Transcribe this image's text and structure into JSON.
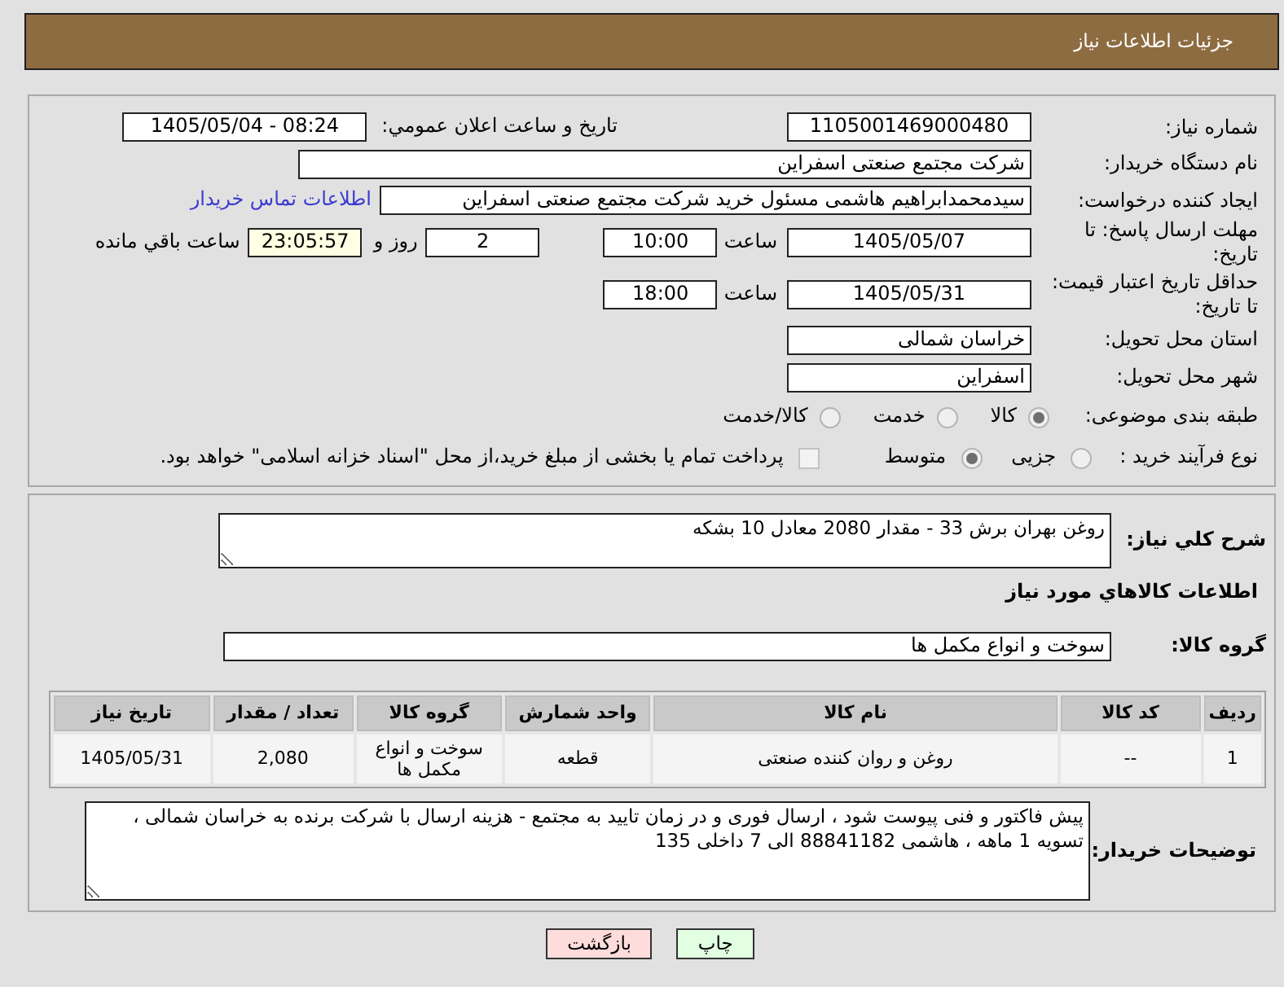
{
  "header": {
    "title": "جزئیات اطلاعات نیاز"
  },
  "details": {
    "need_number": {
      "label": "شماره نیاز:",
      "value": "1105001469000480"
    },
    "announce_datetime": {
      "label": "تاریخ و ساعت اعلان عمومي:",
      "value": "1405/05/04 - 08:24"
    },
    "buyer_org": {
      "label": "نام دستگاه خریدار:",
      "value": "شرکت مجتمع صنعتی اسفراین"
    },
    "requester": {
      "label": "ایجاد کننده درخواست:",
      "value": "سیدمحمدابراهیم هاشمی مسئول خرید شرکت مجتمع صنعتی اسفراین",
      "link": "اطلاعات تماس خریدار"
    },
    "response_deadline": {
      "label": "مهلت ارسال پاسخ: تا تاریخ:",
      "date": "1405/05/07",
      "time_label": "ساعت",
      "time": "10:00",
      "days": "2",
      "days_label": "روز و",
      "remaining": "23:05:57",
      "remaining_label": "ساعت باقي مانده"
    },
    "price_validity": {
      "label": "حداقل تاریخ اعتبار قیمت: تا تاریخ:",
      "date": "1405/05/31",
      "time_label": "ساعت",
      "time": "18:00"
    },
    "province": {
      "label": "استان محل تحویل:",
      "value": "خراسان شمالی"
    },
    "city": {
      "label": "شهر محل تحویل:",
      "value": "اسفراین"
    },
    "category": {
      "label": "طبقه بندی موضوعی:",
      "disabled": true,
      "options": [
        {
          "label": "کالا",
          "selected": true
        },
        {
          "label": "خدمت",
          "selected": false
        },
        {
          "label": "کالا/خدمت",
          "selected": false
        }
      ]
    },
    "process_type": {
      "label": "نوع فرآیند خرید :",
      "disabled": true,
      "options": [
        {
          "label": "جزیی",
          "selected": false
        },
        {
          "label": "متوسط",
          "selected": true
        }
      ],
      "treasury": {
        "label": "پرداخت تمام یا بخشی از مبلغ خرید،از محل \"اسناد خزانه اسلامی\" خواهد بود.",
        "checked": false
      }
    }
  },
  "summary": {
    "label": "شرح کلي نیاز:",
    "value": "روغن بهران برش 33 - مقدار 2080 معادل 10 بشکه"
  },
  "goods": {
    "title": "اطلاعات کالاهاي مورد نیاز",
    "group_label": "گروه کالا:",
    "group": "سوخت و انواع مکمل ها",
    "table": {
      "columns": [
        "ردیف",
        "کد کالا",
        "نام کالا",
        "واحد شمارش",
        "گروه کالا",
        "تعداد / مقدار",
        "تاریخ نیاز"
      ],
      "rows": [
        [
          "1",
          "--",
          "روغن و روان کننده صنعتی",
          "قطعه",
          "سوخت و انواع مکمل ها",
          "2,080",
          "1405/05/31"
        ]
      ]
    }
  },
  "buyer_notes": {
    "label": "توضیحات خریدار:",
    "value": "پیش فاکتور و فنی پیوست شود ، ارسال فوری و در زمان تایید به مجتمع - هزینه ارسال با شرکت برنده به خراسان شمالی ، تسویه 1 ماهه ، هاشمی 88841182 الی 7 داخلی 135"
  },
  "buttons": [
    {
      "label": "چاپ",
      "kind": "print"
    },
    {
      "label": "بازگشت",
      "kind": "back"
    }
  ]
}
